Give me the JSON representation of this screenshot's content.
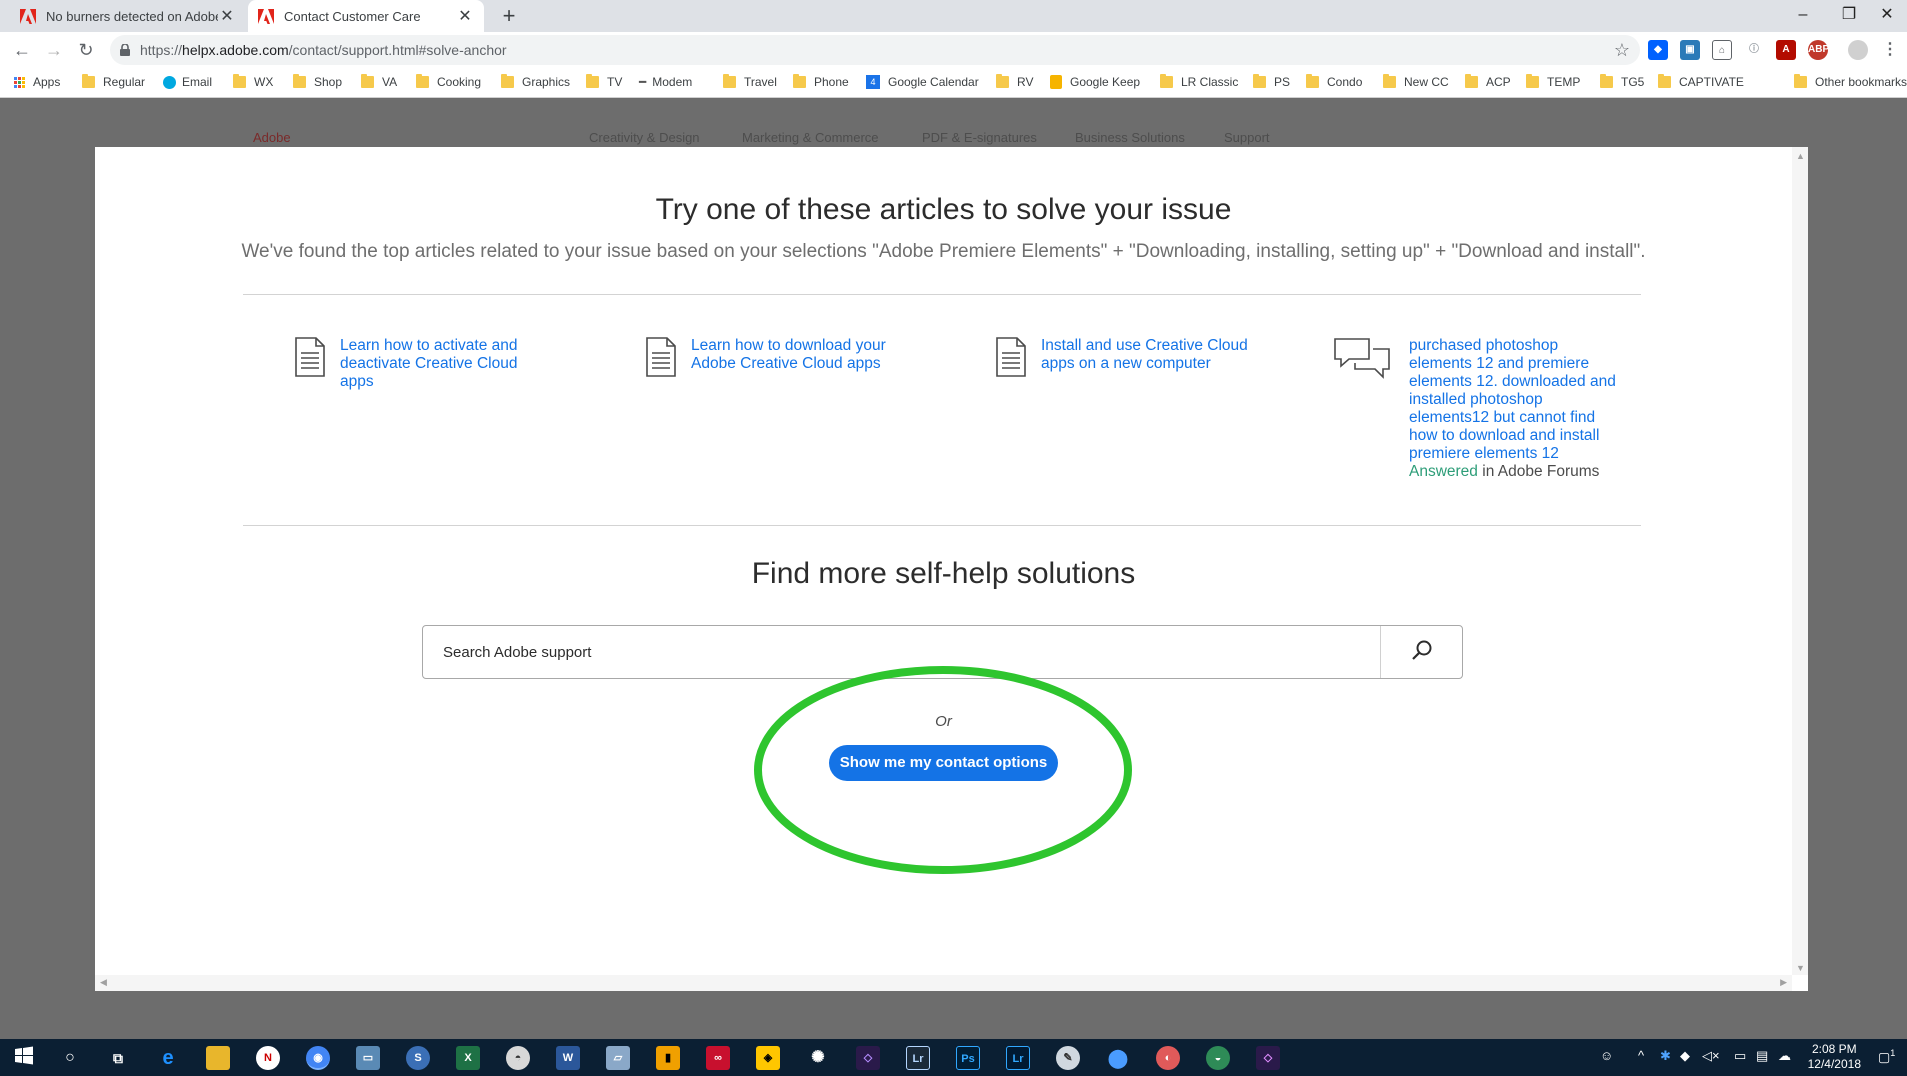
{
  "browser": {
    "tabs": [
      {
        "title": "No burners detected on Adobe Premiere Elements",
        "active": false
      },
      {
        "title": "Contact Customer Care",
        "active": true
      }
    ],
    "url": {
      "scheme": "https://",
      "host": "helpx.adobe.com",
      "path": "/contact/support.html#solve-anchor"
    },
    "bookmarks": [
      "Apps",
      "Regular",
      "Email",
      "WX",
      "Shop",
      "VA",
      "Cooking",
      "Graphics",
      "TV",
      "Modem",
      "Travel",
      "Phone",
      "Google Calendar",
      "RV",
      "Google Keep",
      "LR Classic",
      "PS",
      "Condo",
      "New CC",
      "ACP",
      "TEMP",
      "TG5",
      "CAPTIVATE"
    ],
    "other_bookmarks": "Other bookmarks"
  },
  "background_nav": {
    "brand": "Adobe",
    "items": [
      "Creativity & Design",
      "Marketing & Commerce",
      "PDF & E-signatures",
      "Business Solutions",
      "Support"
    ]
  },
  "modal": {
    "title": "Try one of these articles to solve your issue",
    "subtitle": "We've found the top articles related to your issue based on your selections \"Adobe Premiere Elements\" + \"Downloading, installing, setting up\" + \"Download and install\".",
    "articles": [
      {
        "lines": [
          "Learn how to activate and",
          "deactivate Creative Cloud",
          "apps"
        ]
      },
      {
        "lines": [
          "Learn how to download your",
          "Adobe Creative Cloud apps"
        ]
      },
      {
        "lines": [
          "Install and use Creative Cloud",
          "apps on a new computer"
        ]
      }
    ],
    "forum_post": {
      "lines": [
        "purchased photoshop",
        "elements 12 and premiere",
        "elements 12. downloaded and",
        "installed photoshop",
        "elements12 but cannot find",
        "how to download and install",
        "premiere elements 12"
      ],
      "status": "Answered",
      "source": "in Adobe Forums"
    },
    "self_help_title": "Find more self-help solutions",
    "search_placeholder": "Search Adobe support",
    "or_text": "Or",
    "contact_button": "Show me my contact options",
    "highlight_color": "#2ec52e",
    "accent_color": "#1473e6"
  },
  "taskbar": {
    "time": "2:08 PM",
    "date": "12/4/2018",
    "notification_count": "1"
  }
}
